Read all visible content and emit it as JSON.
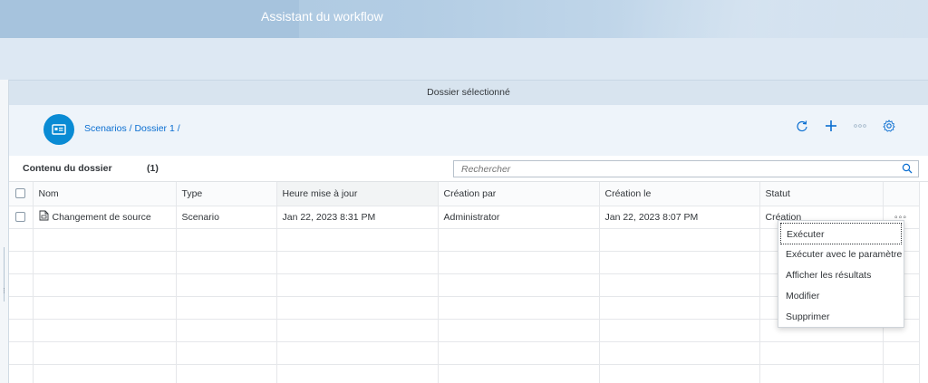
{
  "header": {
    "title": "Assistant du workflow"
  },
  "folder_bar": {
    "label": "Dossier sélectionné"
  },
  "breadcrumb": {
    "text": "Scenarios / Dossier 1 /"
  },
  "toolbar": {
    "icons": [
      "refresh-icon",
      "add-icon",
      "more-icon",
      "settings-icon"
    ]
  },
  "list": {
    "title": "Contenu du dossier",
    "count": "(1)",
    "search_placeholder": "Rechercher"
  },
  "table": {
    "columns": [
      "Nom",
      "Type",
      "Heure mise à jour",
      "Création par",
      "Création le",
      "Statut"
    ],
    "rows": [
      {
        "name": "Changement de source",
        "type": "Scenario",
        "updated": "Jan 22, 2023 8:31 PM",
        "created_by": "Administrator",
        "created_on": "Jan 22, 2023 8:07 PM",
        "status": "Création",
        "more": "◦◦◦"
      }
    ]
  },
  "context_menu": {
    "items": [
      "Exécuter",
      "Exécuter avec le paramètre",
      "Afficher les résultats",
      "Modifier",
      "Supprimer"
    ]
  },
  "colors": {
    "accent": "#0a6ed1",
    "avatar": "#0a8bd4",
    "header": "#a9c5de"
  }
}
